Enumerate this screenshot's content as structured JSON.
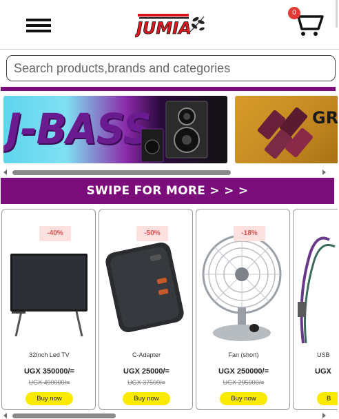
{
  "header": {
    "logo_text": "JUMIA",
    "cart_count": "0",
    "icons": {
      "menu": "hamburger-icon",
      "cart": "cart-icon"
    }
  },
  "search": {
    "placeholder": "Search products,brands and categories"
  },
  "banners": [
    {
      "text": "J-BASS"
    },
    {
      "text": "GR"
    }
  ],
  "swipe": {
    "label": "SWIPE FOR MORE > > >"
  },
  "products": [
    {
      "discount": "-40%",
      "name": "32Inch Led TV",
      "price": "UGX 350000/=",
      "old_price": "UGX 490000/=",
      "buy": "Buy now"
    },
    {
      "discount": "-50%",
      "name": "C-Adapter",
      "price": "UGX 25000/=",
      "old_price": "UGX 37500/=",
      "buy": "Buy now"
    },
    {
      "discount": "-18%",
      "name": "Fan (short)",
      "price": "UGX 250000/=",
      "old_price": "UGX 295000/=",
      "buy": "Buy now"
    },
    {
      "discount": "",
      "name": "USB",
      "price": "UGX",
      "old_price": "",
      "buy": "B"
    }
  ],
  "colors": {
    "brand_purple": "#7b0d7b",
    "accent_red": "#e53935",
    "buy_yellow": "#f9ea00"
  }
}
